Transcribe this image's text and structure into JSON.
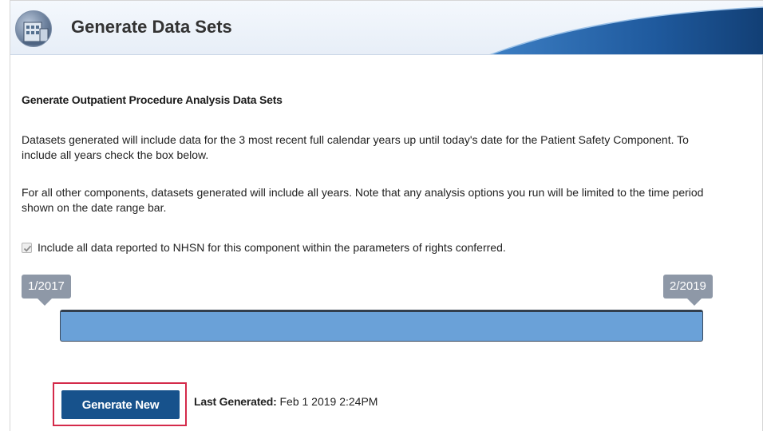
{
  "header": {
    "title": "Generate Data Sets",
    "icon": "building-icon"
  },
  "main": {
    "section_title": "Generate Outpatient Procedure Analysis Data Sets",
    "paragraph1": "Datasets generated will include data for the 3 most recent full calendar years up until today's date for the Patient Safety Component. To include all years check the box below.",
    "paragraph2": "For all other components, datasets generated will include all years. Note that any analysis options you run will be limited to the time period shown on the date range bar.",
    "checkbox": {
      "label": "Include all data reported to NHSN for this component within the parameters of rights conferred.",
      "checked": true,
      "disabled": true
    },
    "date_range": {
      "start": "1/2017",
      "end": "2/2019"
    },
    "generate_button": "Generate New",
    "last_generated": {
      "label": "Last Generated:",
      "value": "Feb 1 2019 2:24PM"
    }
  },
  "colors": {
    "button": "#17528c",
    "range_bar": "#6aa1d8",
    "range_label": "#8e98a7",
    "highlight": "#d42a4a"
  }
}
